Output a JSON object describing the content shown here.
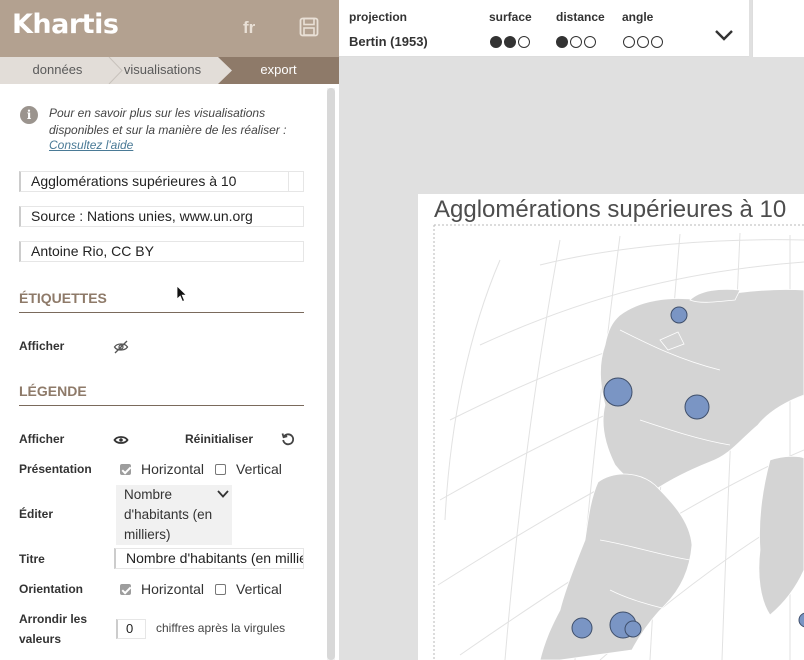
{
  "header": {
    "logo": "Khartis",
    "lang": "fr",
    "save_icon": "floppy-disk-icon"
  },
  "steps": [
    {
      "label": "données",
      "active": false
    },
    {
      "label": "visualisations",
      "active": false
    },
    {
      "label": "export",
      "active": true
    }
  ],
  "projection": {
    "projection_label": "projection",
    "projection_value": "Bertin (1953)",
    "surface_label": "surface",
    "surface_level": 2,
    "distance_label": "distance",
    "distance_level": 1,
    "angle_label": "angle",
    "angle_level": 0,
    "max_level": 3
  },
  "panel": {
    "info_text": "Pour en savoir plus sur les visualisations disponibles et sur la manière de les réaliser :",
    "help_link": "Consultez l'aide",
    "title_field": "Agglomérations supérieures à 10",
    "source_field": "Source : Nations unies, www.un.org",
    "author_field": "Antoine Rio, CC BY",
    "labels_section": "ÉTIQUETTES",
    "labels_show": "Afficher",
    "legend_section": "LÉGENDE",
    "legend_show": "Afficher",
    "reset": "Réinitialiser",
    "presentation_label": "Présentation",
    "horizontal": "Horizontal",
    "vertical": "Vertical",
    "presentation_horizontal_checked": true,
    "presentation_vertical_checked": false,
    "edit_label": "Éditer",
    "edit_value": "Nombre d'habitants (en milliers)",
    "titre_label": "Titre",
    "titre_value": "Nombre d'habitants (en milliers)",
    "orientation_label": "Orientation",
    "orientation_horizontal_checked": true,
    "orientation_vertical_checked": false,
    "round_label_1": "Arrondir les",
    "round_label_2": "valeurs",
    "round_value": "0",
    "round_suffix": "chiffres après la virgules"
  },
  "map": {
    "title": "Agglomérations supérieures à 10",
    "land_color": "#d4d4d4",
    "bubble_color": "#7a95c4",
    "bubble_stroke": "#3f4f6b"
  }
}
